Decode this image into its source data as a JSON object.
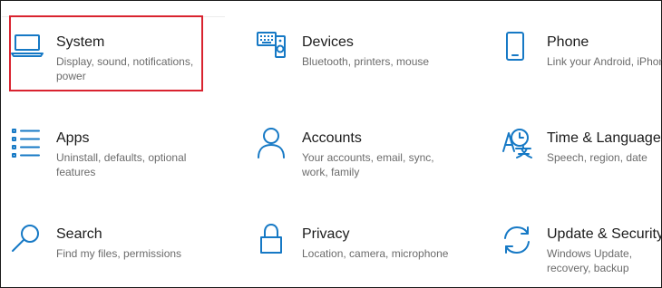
{
  "settings_tiles": [
    {
      "title": "System",
      "description": "Display, sound, notifications, power",
      "icon": "laptop-icon"
    },
    {
      "title": "Devices",
      "description": "Bluetooth, printers, mouse",
      "icon": "keyboard-speaker-icon"
    },
    {
      "title": "Phone",
      "description": "Link your Android, iPhone",
      "icon": "phone-icon"
    },
    {
      "title": "Apps",
      "description": "Uninstall, defaults, optional features",
      "icon": "apps-list-icon"
    },
    {
      "title": "Accounts",
      "description": "Your accounts, email, sync, work, family",
      "icon": "person-icon"
    },
    {
      "title": "Time & Language",
      "description": "Speech, region, date",
      "icon": "time-language-icon"
    },
    {
      "title": "Search",
      "description": "Find my files, permissions",
      "icon": "search-icon"
    },
    {
      "title": "Privacy",
      "description": "Location, camera, microphone",
      "icon": "lock-icon"
    },
    {
      "title": "Update & Security",
      "description": "Windows Update, recovery, backup",
      "icon": "sync-arrows-icon"
    }
  ],
  "colors": {
    "accent": "#1679c5",
    "highlight_border": "#d9232f",
    "title_text": "#1b1b1b",
    "description_text": "#6b6b6b"
  }
}
